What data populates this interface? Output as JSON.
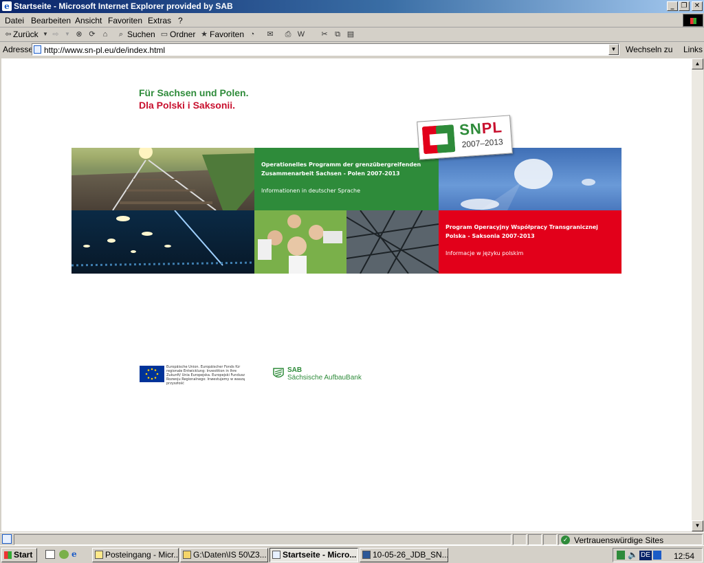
{
  "window": {
    "title": "Startseite - Microsoft Internet Explorer provided by SAB"
  },
  "menu": [
    "Datei",
    "Bearbeiten",
    "Ansicht",
    "Favoriten",
    "Extras",
    "?"
  ],
  "toolbar": {
    "back": "Zurück",
    "search": "Suchen",
    "folders": "Ordner",
    "favorites": "Favoriten"
  },
  "address": {
    "label": "Adresse",
    "url": "http://www.sn-pl.eu/de/index.html",
    "go": "Wechseln zu",
    "links": "Links"
  },
  "page": {
    "headline_de": "Für Sachsen und Polen.",
    "headline_pl": "Dla Polski i Saksonii.",
    "logo": {
      "text_sn": "SN",
      "text_pl": "PL",
      "years": "2007–2013"
    },
    "panel_de": {
      "title1": "Operationelles Programm der grenzübergreifenden",
      "title2": "Zusammenarbeit Sachsen - Polen 2007-2013",
      "link": "Informationen in deutscher Sprache"
    },
    "panel_pl": {
      "title1": "Program Operacyjny Współpracy Transgranicznej",
      "title2": "Polska - Saksonia 2007-2013",
      "link": "Informacje w języku polskim"
    },
    "eu_text": "Europäische Union. Europäischer Fonds für regionale Entwicklung: Investition in Ihre Zukunft/ Unia Europejska. Europejski Fundusz Rozwoju Regionalnego: Inwestujemy w waszą przyszłość",
    "sab": {
      "line1": "SAB",
      "line2": "Sächsische AufbauBank"
    }
  },
  "statusbar": {
    "zone": "Vertrauenswürdige Sites"
  },
  "taskbar": {
    "start": "Start",
    "tasks": [
      "Posteingang - Micr...",
      "G:\\Daten\\IS 50\\Z3...",
      "Startseite - Micro...",
      "10-05-26_JDB_SN..."
    ],
    "lang": "DE",
    "clock": "12:54"
  },
  "colors": {
    "green": "#2e8b3a",
    "red": "#c8102e",
    "titlebar": "#0a246a"
  }
}
